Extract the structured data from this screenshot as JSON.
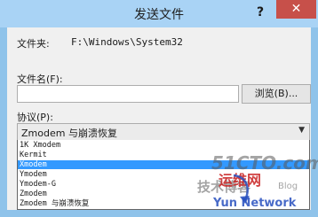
{
  "window": {
    "title": "发送文件",
    "help_label": "?",
    "close_label": "✕"
  },
  "folder": {
    "label": "文件夹:",
    "value": "F:\\Windows\\System32"
  },
  "filename": {
    "label": "文件名(F):",
    "value": "",
    "browse_label": "浏览(B)..."
  },
  "protocol": {
    "label": "协议(P):",
    "selected": "Zmodem 与崩溃恢复",
    "options": [
      "1K Xmodem",
      "Kermit",
      "Xmodem",
      "Ymodem",
      "Ymodem-G",
      "Zmodem",
      "Zmodem 与崩溃恢复"
    ],
    "highlighted_option": "Xmodem"
  },
  "watermark": {
    "line1": "51CTO.com",
    "line2_cn": "技术博客",
    "line2_en": "Blog",
    "yun_net": "运维网",
    "yun_network": "Yun Network"
  },
  "colors": {
    "title_bar": "#a9d3f5",
    "close_button": "#c7504a",
    "selection": "#3399ff"
  }
}
